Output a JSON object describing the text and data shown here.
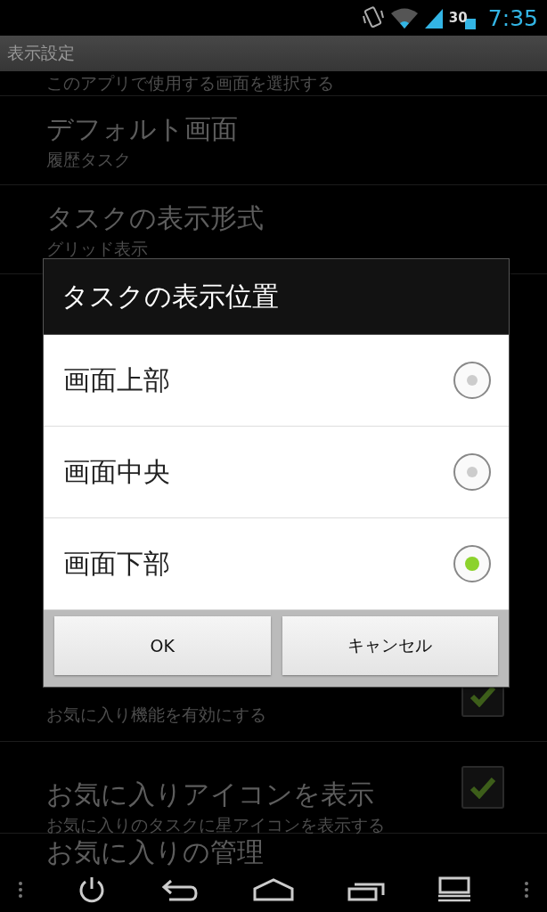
{
  "status_bar": {
    "battery_text": "30",
    "time": "7:35"
  },
  "title_bar": {
    "title": "表示設定"
  },
  "settings_top": [
    {
      "kind": "partial",
      "summary": "このアプリで使用する画面を選択する"
    },
    {
      "kind": "plain",
      "title": "デフォルト画面",
      "summary": "履歴タスク"
    },
    {
      "kind": "plain",
      "title": "タスクの表示形式",
      "summary": "グリッド表示"
    }
  ],
  "settings_bottom": [
    {
      "kind": "checkbox",
      "summary": "お気に入り機能を有効にする",
      "checked": true
    },
    {
      "kind": "checkbox",
      "title": "お気に入りアイコンを表示",
      "summary": "お気に入りのタスクに星アイコンを表示する",
      "checked": true
    },
    {
      "kind": "last",
      "title": "お気に入りの管理"
    }
  ],
  "dialog": {
    "title": "タスクの表示位置",
    "options": [
      {
        "label": "画面上部",
        "selected": false
      },
      {
        "label": "画面中央",
        "selected": false
      },
      {
        "label": "画面下部",
        "selected": true
      }
    ],
    "buttons": [
      "OK",
      "キャンセル"
    ]
  }
}
